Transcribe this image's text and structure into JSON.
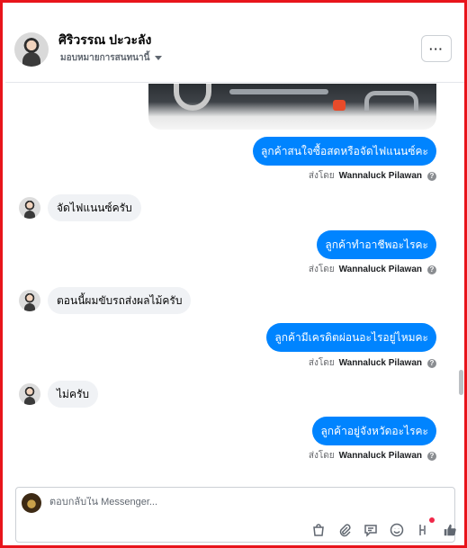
{
  "header": {
    "contact_name": "ศิริวรรณ ปะวะลัง",
    "assign_label": "มอบหมายการสนทนานี้",
    "more_label": "···"
  },
  "messages": {
    "out_1": "ลูกค้าสนใจซื้อสดหรือจัดไฟแนนซ์คะ",
    "in_1": "จัดไฟแนนซ์ครับ",
    "out_2": "ลูกค้าทำอาชีพอะไรคะ",
    "in_2": "ตอนนี้ผมขับรถส่งผลไม้ครับ",
    "out_3": "ลูกค้ามีเครดิตผ่อนอะไรอยู่ไหมคะ",
    "in_3": "ไม่ครับ",
    "out_4": "ลูกค้าอยู่จังหวัดอะไรคะ"
  },
  "sent_by": {
    "prefix": "ส่งโดย",
    "agent": "Wannaluck Pilawan",
    "info": "?"
  },
  "composer": {
    "placeholder": "ตอบกลับใน Messenger..."
  },
  "colors": {
    "accent": "#0084ff",
    "incoming_bubble": "#f0f2f5",
    "frame": "#e8141b"
  },
  "icons": [
    "shopping-bag-icon",
    "paperclip-icon",
    "saved-reply-icon",
    "emoji-icon",
    "gif-icon",
    "thumbs-up-icon"
  ]
}
